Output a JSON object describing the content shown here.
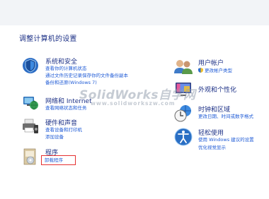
{
  "title": "调整计算机的设置",
  "left": [
    {
      "heading": "系统和安全",
      "icon": "security-shield-icon",
      "links": [
        "查看你的计算机状态",
        "通过文件历史记录保存你的文件备份副本",
        "备份和还原(Windows 7)"
      ]
    },
    {
      "heading": "网络和 Internet",
      "icon": "network-globe-icon",
      "links": [
        "查看网络状态和任务"
      ]
    },
    {
      "heading": "硬件和声音",
      "icon": "printer-speaker-icon",
      "links": [
        "查看设备和打印机",
        "添加设备"
      ]
    },
    {
      "heading": "程序",
      "icon": "programs-box-icon",
      "links": [
        "卸载程序"
      ]
    }
  ],
  "right": [
    {
      "heading": "用户帐户",
      "icon": "users-icon",
      "links": [
        "更改帐户类型"
      ]
    },
    {
      "heading": "外观和个性化",
      "icon": "appearance-monitor-icon",
      "links": []
    },
    {
      "heading": "时钟和区域",
      "icon": "clock-globe-icon",
      "links": [
        "更改日期、时间或数字格式"
      ]
    },
    {
      "heading": "轻松使用",
      "icon": "ease-of-access-icon",
      "links": [
        "使用 Windows 建议的设置",
        "优化视觉显示"
      ]
    }
  ],
  "watermark": {
    "line1": "SolidWorks自学网",
    "line2": "www.solidworkszw.com"
  },
  "colors": {
    "heading": "#1e3287",
    "link": "#1f5bd6",
    "highlight": "#e53030"
  }
}
